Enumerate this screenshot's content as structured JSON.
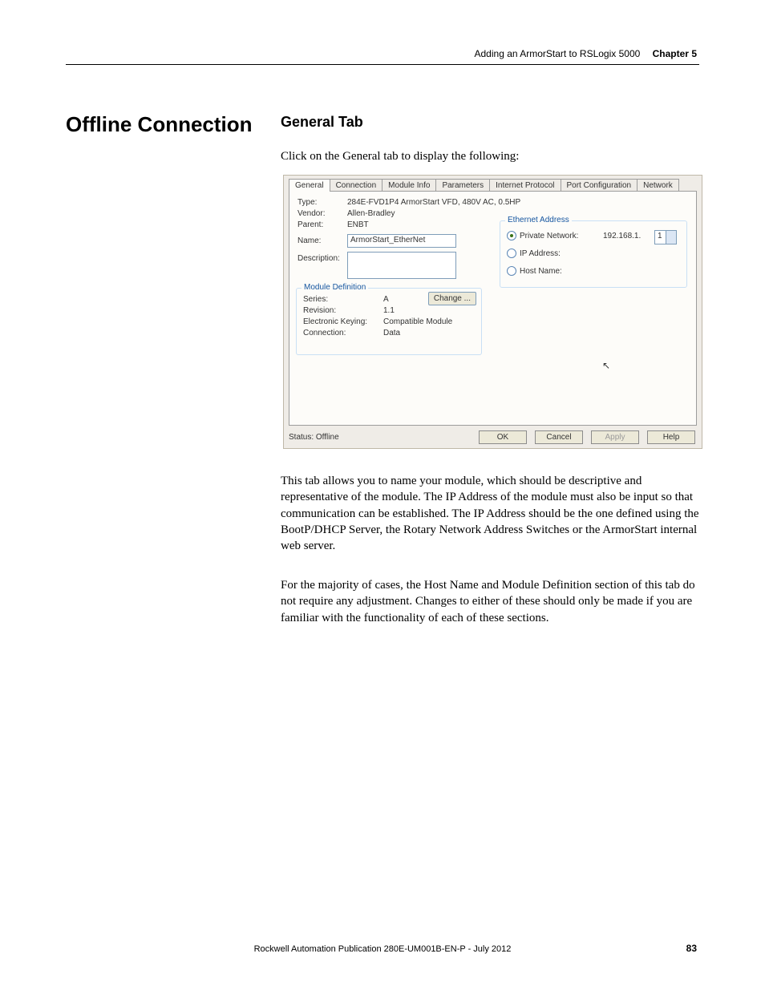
{
  "header": {
    "breadcrumb": "Adding an ArmorStart to RSLogix 5000",
    "chapter_label": "Chapter 5"
  },
  "h1": "Offline Connection",
  "h2": "General Tab",
  "intro": "Click on the General tab to display the following:",
  "screenshot": {
    "tabs": [
      "General",
      "Connection",
      "Module Info",
      "Parameters",
      "Internet Protocol",
      "Port Configuration",
      "Network"
    ],
    "type_label": "Type:",
    "type_value": "284E-FVD1P4 ArmorStart VFD, 480V AC, 0.5HP",
    "vendor_label": "Vendor:",
    "vendor_value": "Allen-Bradley",
    "parent_label": "Parent:",
    "parent_value": "ENBT",
    "name_label": "Name:",
    "name_value": "ArmorStart_EtherNet",
    "desc_label": "Description:",
    "moddef_legend": "Module Definition",
    "series_label": "Series:",
    "series_value": "A",
    "rev_label": "Revision:",
    "rev_value": "1.1",
    "keying_label": "Electronic Keying:",
    "keying_value": "Compatible Module",
    "conn_label": "Connection:",
    "conn_value": "Data",
    "change_btn": "Change ...",
    "eth_legend": "Ethernet Address",
    "pn_label": "Private Network:",
    "pn_value": "192.168.1.",
    "ip_label": "IP Address:",
    "host_label": "Host Name:",
    "spin_value": "1",
    "status": "Status: Offline",
    "ok": "OK",
    "cancel": "Cancel",
    "apply": "Apply",
    "help": "Help"
  },
  "para1": "This tab allows you to name your module, which should be descriptive and representative of the module. The IP Address of the module must also be input so that communication can be established. The IP Address should be the one defined using the BootP/DHCP Server, the Rotary Network Address Switches or the ArmorStart internal web server.",
  "para2": "For the majority of cases, the Host Name and Module Definition section of this tab do not require any adjustment. Changes to either of these should only be made if you are familiar with the functionality of each of these sections.",
  "footer": "Rockwell Automation Publication 280E-UM001B-EN-P - July 2012",
  "pagenum": "83"
}
